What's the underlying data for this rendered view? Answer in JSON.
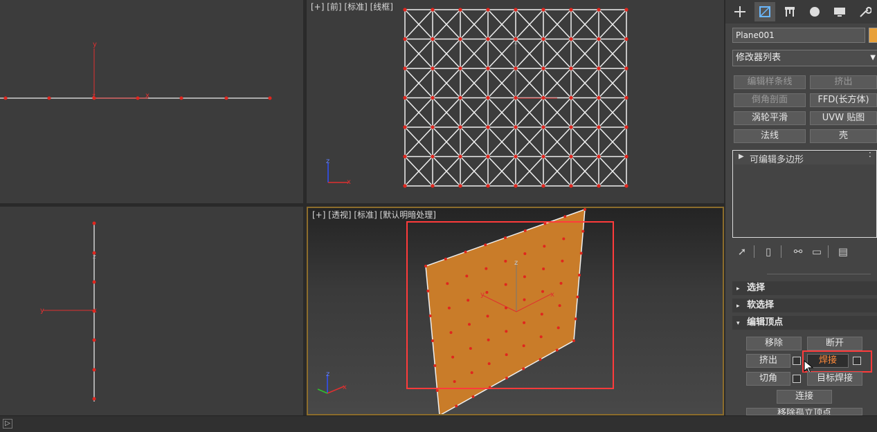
{
  "viewports": {
    "front_label": "[+] [前] [标准] [线框]",
    "perspective_label": "[+] [透视] [标准] [默认明暗处理]"
  },
  "axes": {
    "x": "x",
    "y": "y",
    "z": "z"
  },
  "command_panel": {
    "tabs": [
      "create-icon",
      "modify-icon",
      "hierarchy-icon",
      "motion-icon",
      "display-icon",
      "utilities-icon"
    ],
    "object_name": "Plane001",
    "object_color": "#e8a13a",
    "modifier_list": "修改器列表",
    "modifier_buttons": [
      "编辑样条线",
      "挤出",
      "倒角剖面",
      "FFD(长方体)",
      "涡轮平滑",
      "UVW 贴图",
      "法线",
      "壳"
    ],
    "stack_item": "可编辑多边形",
    "sections": [
      "选择",
      "软选择",
      "编辑顶点"
    ],
    "edit_vertex_buttons": {
      "remove": "移除",
      "break": "断开",
      "extrude": "挤出",
      "weld": "焊接",
      "chamfer": "切角",
      "target_weld": "目标焊接",
      "connect": "连接",
      "remove_isolated": "移除孤立顶点"
    }
  },
  "status": {
    "expand_glyph": "▷"
  },
  "colors": {
    "accent": "#e8a13a",
    "highlight": "#ff3b3b",
    "vertex": "#e0261e"
  }
}
